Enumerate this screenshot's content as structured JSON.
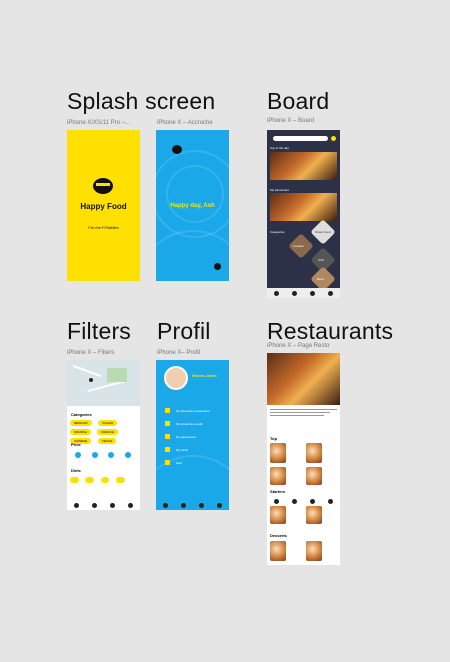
{
  "sections": {
    "splash": "Splash screen",
    "board": "Board",
    "filters": "Filters",
    "profil": "Profil",
    "restaurants": "Restaurants"
  },
  "frames": {
    "splash_label": "iPhone X/XS/11 Pro –...",
    "accroche_label": "iPhone X – Accroche",
    "board_label": "iPhone X – Board",
    "filters_label": "iPhone X – Filters",
    "profil_label": "iPhone X– Profil",
    "resto_label": "iPhone X – Page Resto"
  },
  "splash": {
    "app_name": "Happy Food",
    "tagline": "For the Fl*0ddles"
  },
  "accroche": {
    "greeting": "Happy day, Ash"
  },
  "board": {
    "rows": [
      "Top of the day",
      "My Favourites",
      "Categories"
    ],
    "hex_labels": [
      "Street Food",
      "Cookies",
      "Chic",
      "Retro"
    ]
  },
  "filters": {
    "categories_label": "Categories",
    "price_label": "Price",
    "diets_label": "Diets",
    "chips": [
      "MEXICAN",
      "ITALIAN",
      "SPANISH",
      "FRENCH",
      "CHINESE",
      "VEGAN"
    ]
  },
  "profil": {
    "name": "Emma Jones",
    "menu": [
      "My favourites restaurants",
      "My favourites meals",
      "My parameters",
      "My cards",
      "Help"
    ]
  },
  "resto": {
    "sections": [
      "Top",
      "Starters",
      "Desserts"
    ]
  },
  "colors": {
    "yellow": "#ffe000",
    "blue": "#1aa8e8",
    "dark": "#2d3147",
    "background": "#e5e5e5"
  }
}
